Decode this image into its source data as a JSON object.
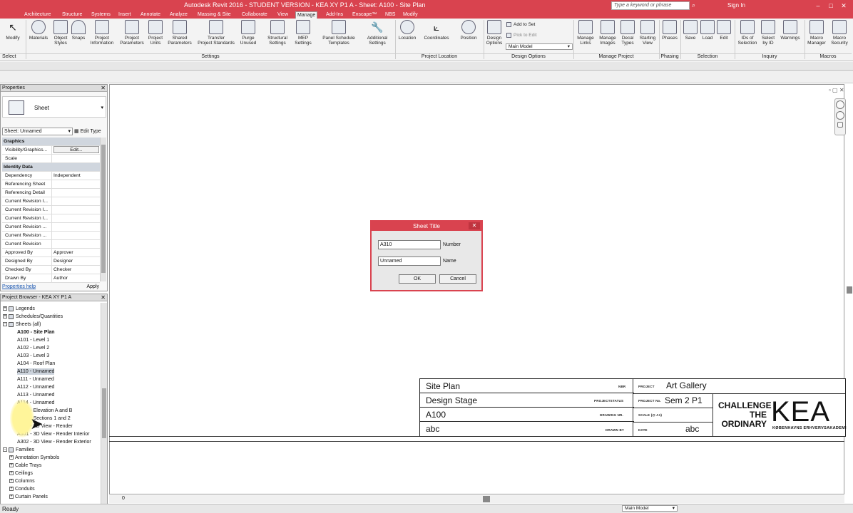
{
  "window": {
    "title": "Autodesk Revit 2016 - STUDENT VERSION -    KEA XY P1 A - Sheet: A100 - Site Plan",
    "search_placeholder": "Type a keyword or phrase",
    "sign_in": "Sign In",
    "accent": "#d9434f"
  },
  "menu_tabs": [
    "Architecture",
    "Structure",
    "Systems",
    "Insert",
    "Annotate",
    "Analyze",
    "Massing & Site",
    "Collaborate",
    "View",
    "Manage",
    "Add-Ins",
    "Enscape™",
    "NBS",
    "Modify"
  ],
  "active_tab": "Manage",
  "ribbon": {
    "select_label": "Select",
    "buttons": {
      "modify": "Modify",
      "materials": "Materials",
      "object_styles": "Object\nStyles",
      "snaps": "Snaps",
      "project_information": "Project\nInformation",
      "project_parameters": "Project\nParameters",
      "project_units": "Project\nUnits",
      "shared_parameters": "Shared\nParameters",
      "transfer_project_standards": "Transfer\nProject Standards",
      "purge_unused": "Purge\nUnused",
      "structural_settings": "Structural\nSettings",
      "mep_settings": "MEP\nSettings",
      "panel_schedule_templates": "Panel Schedule\nTemplates",
      "additional_settings": "Additional\nSettings",
      "location": "Location",
      "coordinates": "Coordinates",
      "position": "Position",
      "design_options": "Design\nOptions",
      "add_to_set": "Add to Set",
      "pick_to_edit": "Pick to Edit",
      "main_model": "Main Model",
      "manage_links": "Manage\nLinks",
      "manage_images": "Manage\nImages",
      "decal_types": "Decal\nTypes",
      "starting_view": "Starting\nView",
      "phases": "Phases",
      "save": "Save",
      "load": "Load",
      "edit": "Edit",
      "ids_of_selection": "IDs of\nSelection",
      "select_by_id": "Select\nby ID",
      "warnings": "Warnings",
      "macro_manager": "Macro\nManager",
      "macro_security": "Macro\nSecurity"
    },
    "panels": {
      "settings": "Settings",
      "project_location": "Project Location",
      "design_options": "Design Options",
      "manage_project": "Manage Project",
      "phasing": "Phasing",
      "selection": "Selection",
      "inquiry": "Inquiry",
      "macros": "Macros"
    }
  },
  "properties": {
    "title": "Properties",
    "type_name": "Sheet",
    "selector": "Sheet: Unnamed",
    "edit_type": "Edit Type",
    "rows": [
      {
        "group": "Graphics"
      },
      {
        "key": "Visibility/Graphics...",
        "value": "Edit..."
      },
      {
        "key": "Scale",
        "value": ""
      },
      {
        "group": "Identity Data"
      },
      {
        "key": "Dependency",
        "value": "Independent"
      },
      {
        "key": "Referencing Sheet",
        "value": ""
      },
      {
        "key": "Referencing Detail",
        "value": ""
      },
      {
        "key": "Current Revision I...",
        "value": ""
      },
      {
        "key": "Current Revision I...",
        "value": ""
      },
      {
        "key": "Current Revision I...",
        "value": ""
      },
      {
        "key": "Current Revision ...",
        "value": ""
      },
      {
        "key": "Current Revision ...",
        "value": ""
      },
      {
        "key": "Current Revision",
        "value": ""
      },
      {
        "key": "Approved By",
        "value": "Approver"
      },
      {
        "key": "Designed By",
        "value": "Designer"
      },
      {
        "key": "Checked By",
        "value": "Checker"
      },
      {
        "key": "Drawn By",
        "value": "Author"
      }
    ],
    "help": "Properties help",
    "apply": "Apply"
  },
  "browser": {
    "title": "Project Browser - KEA XY P1 A",
    "items": [
      {
        "label": "Legends",
        "level": 0,
        "box": "+"
      },
      {
        "label": "Schedules/Quantities",
        "level": 0,
        "box": "+"
      },
      {
        "label": "Sheets (all)",
        "level": 0,
        "box": "-"
      },
      {
        "label": "A100 - Site Plan",
        "level": 1,
        "bold": true
      },
      {
        "label": "A101 - Level 1",
        "level": 1
      },
      {
        "label": "A102 - Level 2",
        "level": 1
      },
      {
        "label": "A103 - Level 3",
        "level": 1
      },
      {
        "label": "A104 - Roof Plan",
        "level": 1
      },
      {
        "label": "A110 - Unnamed",
        "level": 1,
        "selected": true
      },
      {
        "label": "A111 - Unnamed",
        "level": 1
      },
      {
        "label": "A112 - Unnamed",
        "level": 1
      },
      {
        "label": "A113 - Unnamed",
        "level": 1
      },
      {
        "label": "A114 - Unnamed",
        "level": 1
      },
      {
        "label": "A200 - Elevation A and B",
        "level": 1
      },
      {
        "label": "A210 - Sections 1 and 2",
        "level": 1
      },
      {
        "label": "A300 - 3D View - Render",
        "level": 1
      },
      {
        "label": "A301 - 3D View - Render Interior",
        "level": 1
      },
      {
        "label": "A302 - 3D View - Render Exterior",
        "level": 1
      },
      {
        "label": "Families",
        "level": 0,
        "box": "-"
      },
      {
        "label": "Annotation Symbols",
        "level": 1,
        "box": "+"
      },
      {
        "label": "Cable Trays",
        "level": 1,
        "box": "+"
      },
      {
        "label": "Ceilings",
        "level": 1,
        "box": "+"
      },
      {
        "label": "Columns",
        "level": 1,
        "box": "+"
      },
      {
        "label": "Conduits",
        "level": 1,
        "box": "+"
      },
      {
        "label": "Curtain Panels",
        "level": 1,
        "box": "+"
      }
    ]
  },
  "dialog": {
    "title": "Sheet Title",
    "number_value": "A310",
    "number_label": "Number",
    "name_value": "Unnamed",
    "name_label": "Name",
    "ok": "OK",
    "cancel": "Cancel"
  },
  "title_block": {
    "sheet_name": "Site Plan",
    "stage": "Design Stage",
    "number": "A100",
    "drawn": "abc",
    "nbr_label": "NBR",
    "stage_label": "PROJECTSTATUS",
    "number_label": "DRAWING NR.",
    "drawn_label": "DRAWN BY",
    "project_label": "PROJECT",
    "project_value": "Art Gallery",
    "project_no_label": "PROJECT No.",
    "project_no_value": "Sem 2 P1",
    "scale_label": "SCALE (@ A1)",
    "date_label": "DATE",
    "date_value": "abc",
    "slogan_1": "CHALLENGE",
    "slogan_2": "THE",
    "slogan_3": "ORDINARY",
    "logo": "KEA",
    "logo_sub": "KØBENHAVNS ERHVERVSAKADEMI"
  },
  "status": {
    "ready": "Ready",
    "zero": "0",
    "model": "Main Model"
  }
}
